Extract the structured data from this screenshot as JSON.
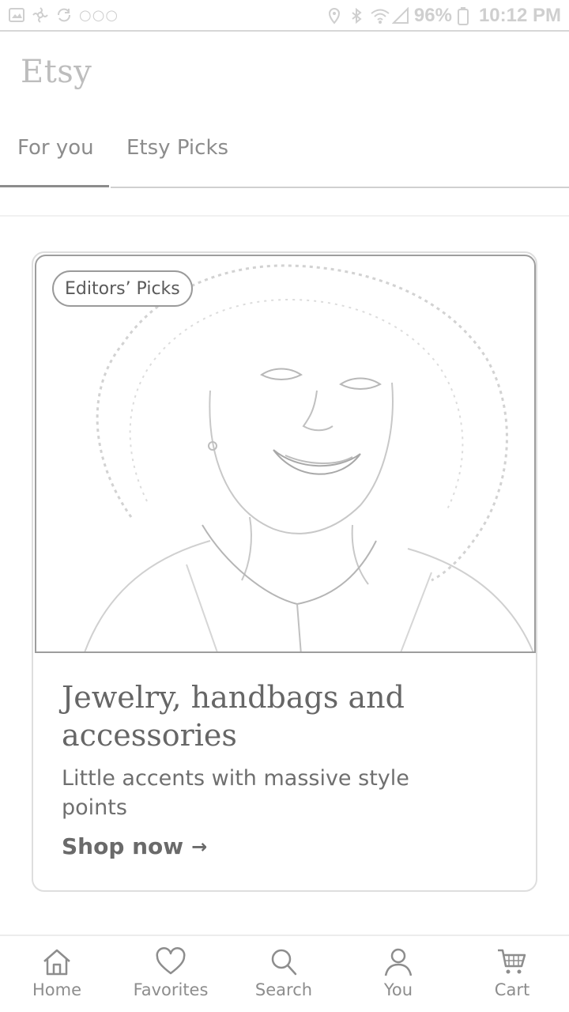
{
  "status_bar": {
    "battery_percent": "96%",
    "time": "10:12 PM",
    "left_icons": [
      "gallery-icon",
      "pinwheel-icon",
      "sync-icon",
      "more-dots-icon"
    ],
    "right_icons": [
      "location-icon",
      "bluetooth-icon",
      "wifi-icon",
      "signal-icon",
      "battery-icon"
    ]
  },
  "header": {
    "logo": "Etsy"
  },
  "tabs": {
    "items": [
      {
        "label": "For you",
        "active": true
      },
      {
        "label": "Etsy Picks",
        "active": false
      }
    ]
  },
  "card": {
    "badge": "Editors’ Picks",
    "title": "Jewelry, handbags and accessories",
    "subtitle": "Little accents with massive style points",
    "cta": "Shop now",
    "cta_arrow": "→"
  },
  "bottom_nav": {
    "items": [
      {
        "label": "Home",
        "icon": "home-icon"
      },
      {
        "label": "Favorites",
        "icon": "heart-icon"
      },
      {
        "label": "Search",
        "icon": "search-icon"
      },
      {
        "label": "You",
        "icon": "user-icon"
      },
      {
        "label": "Cart",
        "icon": "cart-icon"
      }
    ]
  },
  "colors": {
    "ui_gray": "#8c8c8c",
    "light_border": "#dedede"
  }
}
